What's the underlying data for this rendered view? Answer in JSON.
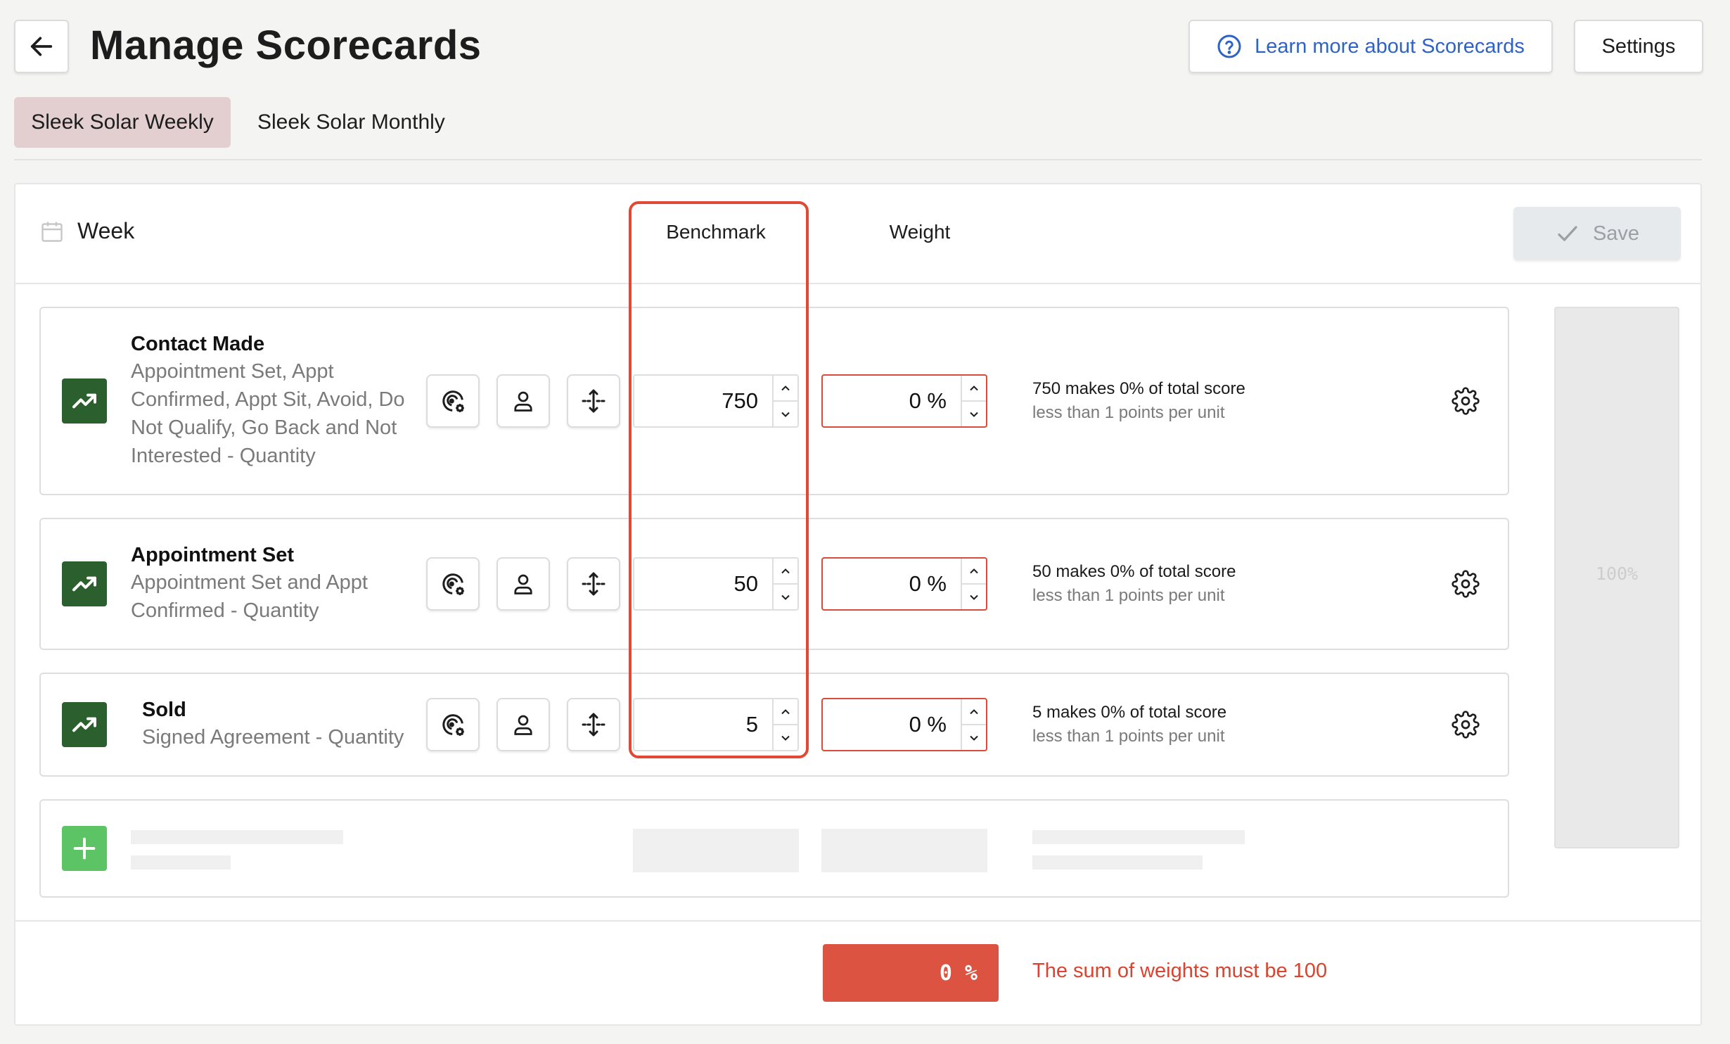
{
  "header": {
    "title": "Manage Scorecards",
    "learn_more": "Learn more about Scorecards",
    "settings": "Settings"
  },
  "tabs": [
    {
      "label": "Sleek Solar Weekly",
      "active": true
    },
    {
      "label": "Sleek Solar Monthly",
      "active": false
    }
  ],
  "panel": {
    "period": "Week",
    "col_benchmark": "Benchmark",
    "col_weight": "Weight",
    "save": "Save",
    "side_total": "100%"
  },
  "metrics": [
    {
      "name": "Contact Made",
      "desc_lines": [
        "Appointment Set, Appt",
        "Confirmed, Appt Sit, Avoid, Do",
        "Not Qualify, Go Back and Not",
        "Interested - Quantity"
      ],
      "benchmark": "750",
      "weight": "0 %",
      "summary": "750 makes 0% of total score",
      "points": "less than 1 points per unit"
    },
    {
      "name": "Appointment Set",
      "desc_lines": [
        "Appointment Set and Appt",
        "Confirmed - Quantity"
      ],
      "benchmark": "50",
      "weight": "0 %",
      "summary": "50 makes 0% of total score",
      "points": "less than 1 points per unit"
    },
    {
      "name": "Sold",
      "desc_lines": [
        "Signed Agreement - Quantity"
      ],
      "benchmark": "5",
      "weight": "0 %",
      "summary": "5 makes 0% of total score",
      "points": "less than 1 points per unit"
    }
  ],
  "footer": {
    "total": "0 %",
    "error": "The sum of weights must be 100"
  },
  "colors": {
    "accent_blue": "#2f62c5",
    "metric_icon_green": "#2b5f2d",
    "add_green": "#5dc466",
    "error_red": "#dc5341",
    "active_tab": "#e3cfd0"
  },
  "icons": [
    "back-arrow-icon",
    "help-circle-icon",
    "calendar-icon",
    "check-icon",
    "trending-up-icon",
    "target-gear-icon",
    "person-icon",
    "move-arrows-icon",
    "chevron-up-icon",
    "chevron-down-icon",
    "gear-icon",
    "plus-icon"
  ]
}
